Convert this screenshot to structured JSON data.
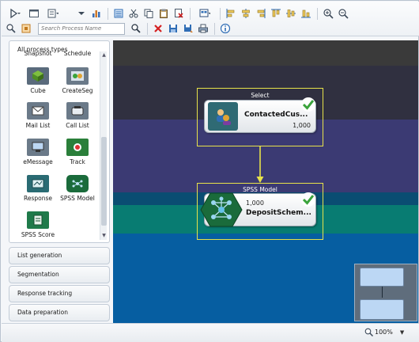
{
  "search": {
    "placeholder": "Search Process Name"
  },
  "palette": {
    "title": "All process types",
    "partial_labels": [
      "Snapshot",
      "Schedule"
    ],
    "items": [
      {
        "label": "Cube",
        "icon": "cube-icon"
      },
      {
        "label": "CreateSeg",
        "icon": "create-segment-icon"
      },
      {
        "label": "Mail List",
        "icon": "mail-list-icon"
      },
      {
        "label": "Call List",
        "icon": "call-list-icon"
      },
      {
        "label": "eMessage",
        "icon": "emessage-icon"
      },
      {
        "label": "Track",
        "icon": "track-icon"
      },
      {
        "label": "Response",
        "icon": "response-icon"
      },
      {
        "label": "SPSS Model",
        "icon": "spss-model-icon"
      },
      {
        "label": "SPSS Score",
        "icon": "spss-score-icon"
      }
    ]
  },
  "accordion": [
    "List generation",
    "Segmentation",
    "Response tracking",
    "Data preparation"
  ],
  "canvas": {
    "groups": [
      {
        "label": "Select",
        "node_title": "ContactedCus...",
        "count": "1,000",
        "status": "complete"
      },
      {
        "label": "SPSS Model",
        "node_title": "DepositSchem...",
        "count": "1,000",
        "status": "complete"
      }
    ]
  },
  "status": {
    "zoom": "100%"
  },
  "colors": {
    "canvas_blue": "#065ea1",
    "band_dark": "#303040",
    "band_purple": "#3b3a73",
    "band_teal": "#087c72",
    "group_border": "#e7e24a",
    "check_green": "#3aa33b"
  }
}
